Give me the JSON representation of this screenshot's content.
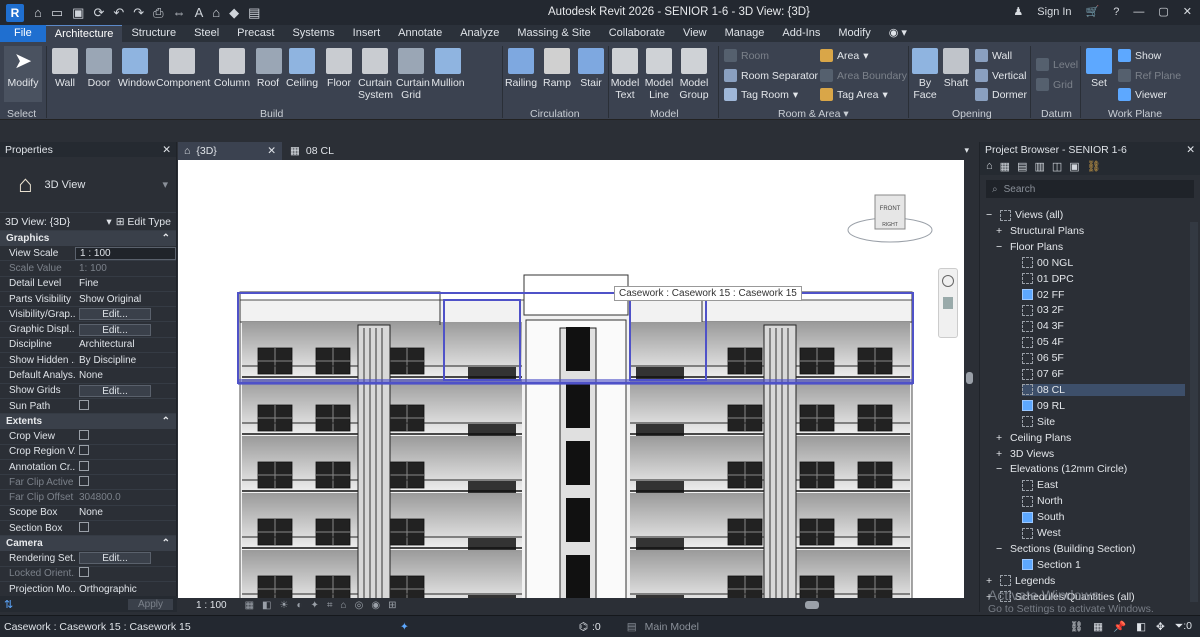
{
  "title_bar": {
    "app_icon": "R",
    "title": "Autodesk Revit 2026 - SENIOR 1-6 - 3D View: {3D}",
    "sign_in": "Sign In"
  },
  "menu": [
    "File",
    "Architecture",
    "Structure",
    "Steel",
    "Precast",
    "Systems",
    "Insert",
    "Annotate",
    "Analyze",
    "Massing & Site",
    "Collaborate",
    "View",
    "Manage",
    "Add-Ins",
    "Modify"
  ],
  "ribbon": {
    "modify": "Modify",
    "select": "Select",
    "build_tools": [
      "Wall",
      "Door",
      "Window",
      "Component",
      "Column",
      "Roof",
      "Ceiling",
      "Floor",
      "Curtain System",
      "Curtain Grid",
      "Mullion"
    ],
    "build": "Build",
    "circulation_tools": [
      "Railing",
      "Ramp",
      "Stair"
    ],
    "circulation": "Circulation",
    "model_tools": [
      "Model Text",
      "Model Line",
      "Model Group"
    ],
    "model": "Model",
    "room": {
      "room": "Room",
      "separator": "Room Separator",
      "tag_room": "Tag Room",
      "area": "Area",
      "area_boundary": "Area Boundary",
      "tag_area": "Tag Area"
    },
    "room_area": "Room & Area",
    "opening_tools": [
      "By Face",
      "Shaft"
    ],
    "opening_small": [
      "Wall",
      "Vertical",
      "Dormer"
    ],
    "opening": "Opening",
    "datum_small": [
      "Level",
      "Grid"
    ],
    "datum": "Datum",
    "wp_set": "Set",
    "wp_small": [
      "Show",
      "Ref Plane",
      "Viewer"
    ],
    "work_plane": "Work Plane"
  },
  "properties": {
    "header": "Properties",
    "type": "3D View",
    "selector": "3D View: {3D}",
    "edit_type": "Edit Type",
    "graphics": "Graphics",
    "rows": [
      [
        "View Scale",
        "1 : 100"
      ],
      [
        "Scale Value",
        "1:  100"
      ],
      [
        "Detail Level",
        "Fine"
      ],
      [
        "Parts Visibility",
        "Show Original"
      ],
      [
        "Visibility/Grap...",
        "Edit..."
      ],
      [
        "Graphic Displ...",
        "Edit..."
      ],
      [
        "Discipline",
        "Architectural"
      ],
      [
        "Show Hidden ...",
        "By Discipline"
      ],
      [
        "Default Analys...",
        "None"
      ],
      [
        "Show Grids",
        "Edit..."
      ],
      [
        "Sun Path",
        ""
      ]
    ],
    "extents": "Extents",
    "extent_rows": [
      [
        "Crop View",
        ""
      ],
      [
        "Crop Region V...",
        ""
      ],
      [
        "Annotation Cr...",
        ""
      ],
      [
        "Far Clip Active",
        ""
      ],
      [
        "Far Clip Offset",
        "304800.0"
      ],
      [
        "Scope Box",
        "None"
      ],
      [
        "Section Box",
        ""
      ]
    ],
    "camera": "Camera",
    "camera_rows": [
      [
        "Rendering Set...",
        "Edit..."
      ],
      [
        "Locked Orient...",
        ""
      ],
      [
        "Projection Mo...",
        "Orthographic"
      ]
    ],
    "apply": "Apply"
  },
  "view_tabs": [
    {
      "label": "{3D}",
      "active": true
    },
    {
      "label": "08 CL",
      "active": false
    }
  ],
  "tooltip": "Casework : Casework 15 : Casework 15",
  "viewcube": {
    "front": "FRONT",
    "right": "RIGHT"
  },
  "view_scale": "1 : 100",
  "browser": {
    "header": "Project Browser - SENIOR 1-6",
    "search": "Search",
    "views_all": "Views (all)",
    "structural": "Structural Plans",
    "floor_plans": "Floor Plans",
    "plans": [
      "00 NGL",
      "01 DPC",
      "02 FF",
      "03 2F",
      "04 3F",
      "05 4F",
      "06 5F",
      "07 6F",
      "08 CL",
      "09 RL",
      "Site"
    ],
    "ceiling": "Ceiling Plans",
    "views3d": "3D Views",
    "elevations": "Elevations (12mm Circle)",
    "elev": [
      "East",
      "North",
      "South",
      "West"
    ],
    "sections": "Sections (Building Section)",
    "section1": "Section 1",
    "legends": "Legends",
    "schedules": "Schedules/Quantities (all)"
  },
  "watermark": {
    "line1": "Activate Windows",
    "line2": "Go to Settings to activate Windows."
  },
  "status": {
    "text": "Casework : Casework 15 : Casework 15",
    "zero1": ":0",
    "model": "Main Model",
    "zero2": ":0"
  },
  "colors": {
    "accent": "#1f6fd0",
    "selection": "#4f52c8"
  }
}
